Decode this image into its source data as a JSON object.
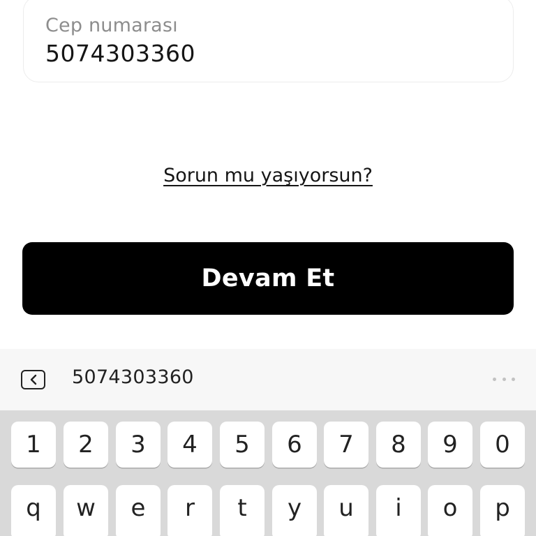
{
  "phone_field": {
    "label": "Cep numarası",
    "value": "5074303360"
  },
  "help_link": "Sorun mu yaşıyorsun?",
  "continue_button": "Devam Et",
  "suggestion_bar": {
    "suggestion": "5074303360"
  },
  "keyboard": {
    "number_row": [
      "1",
      "2",
      "3",
      "4",
      "5",
      "6",
      "7",
      "8",
      "9",
      "0"
    ],
    "letter_row": [
      "q",
      "w",
      "e",
      "r",
      "t",
      "y",
      "u",
      "i",
      "o",
      "p"
    ]
  }
}
